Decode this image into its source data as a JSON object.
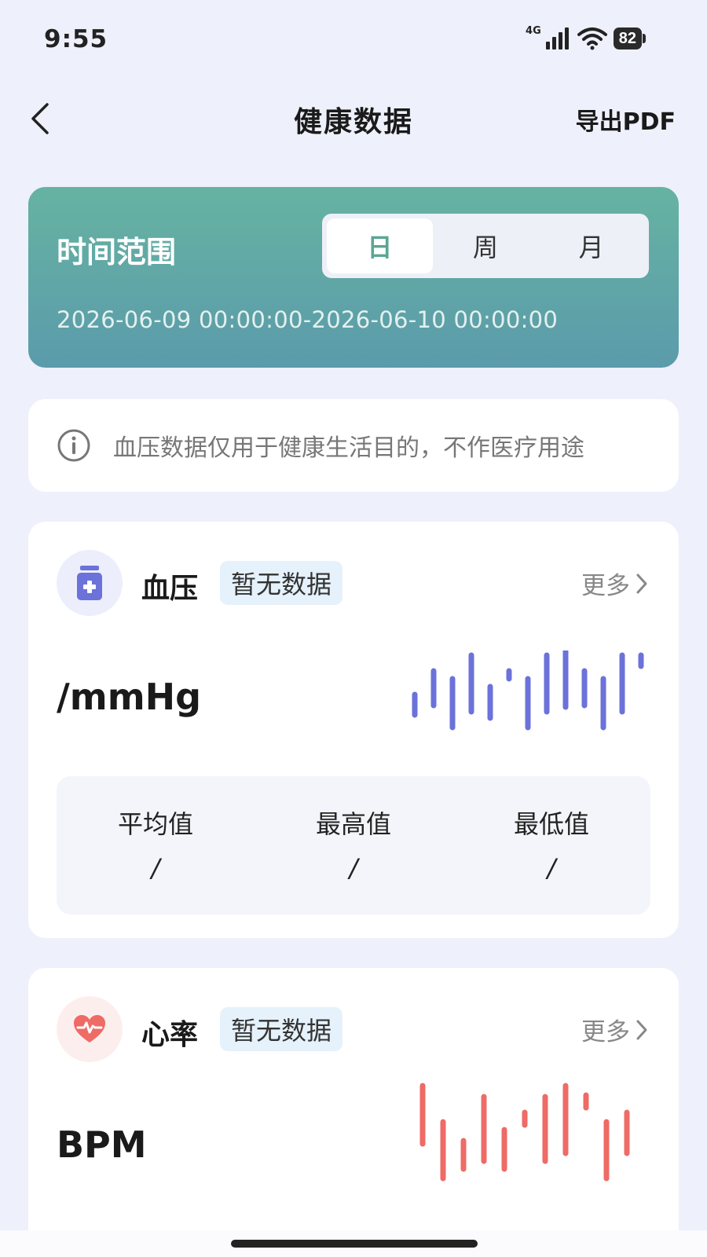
{
  "status_bar": {
    "time": "9:55",
    "network_label": "4G",
    "battery_level": "82"
  },
  "nav": {
    "title": "健康数据",
    "export_label": "导出PDF",
    "back_icon": "chevron-left-icon"
  },
  "time_range": {
    "label": "时间范围",
    "tabs": [
      "日",
      "周",
      "月"
    ],
    "selected_tab": "日",
    "date_range": "2026-06-09 00:00:00-2026-06-10 00:00:00",
    "gradient_colors": [
      "#66b3a2",
      "#5b9bab"
    ]
  },
  "notice": {
    "icon": "info-icon",
    "text": "血压数据仅用于健康生活目的，不作医疗用途"
  },
  "blood_pressure": {
    "icon": "medicine-bottle-icon",
    "name": "血压",
    "status": "暂无数据",
    "more_label": "更多",
    "unit": "/mmHg",
    "accent_color": "#6b72d9",
    "stats": [
      {
        "label": "平均值",
        "value": "/"
      },
      {
        "label": "最高值",
        "value": "/"
      },
      {
        "label": "最低值",
        "value": "/"
      }
    ]
  },
  "heart_rate": {
    "icon": "heart-pulse-icon",
    "name": "心率",
    "status": "暂无数据",
    "more_label": "更多",
    "unit": "BPM",
    "accent_color": "#ee6b66"
  }
}
